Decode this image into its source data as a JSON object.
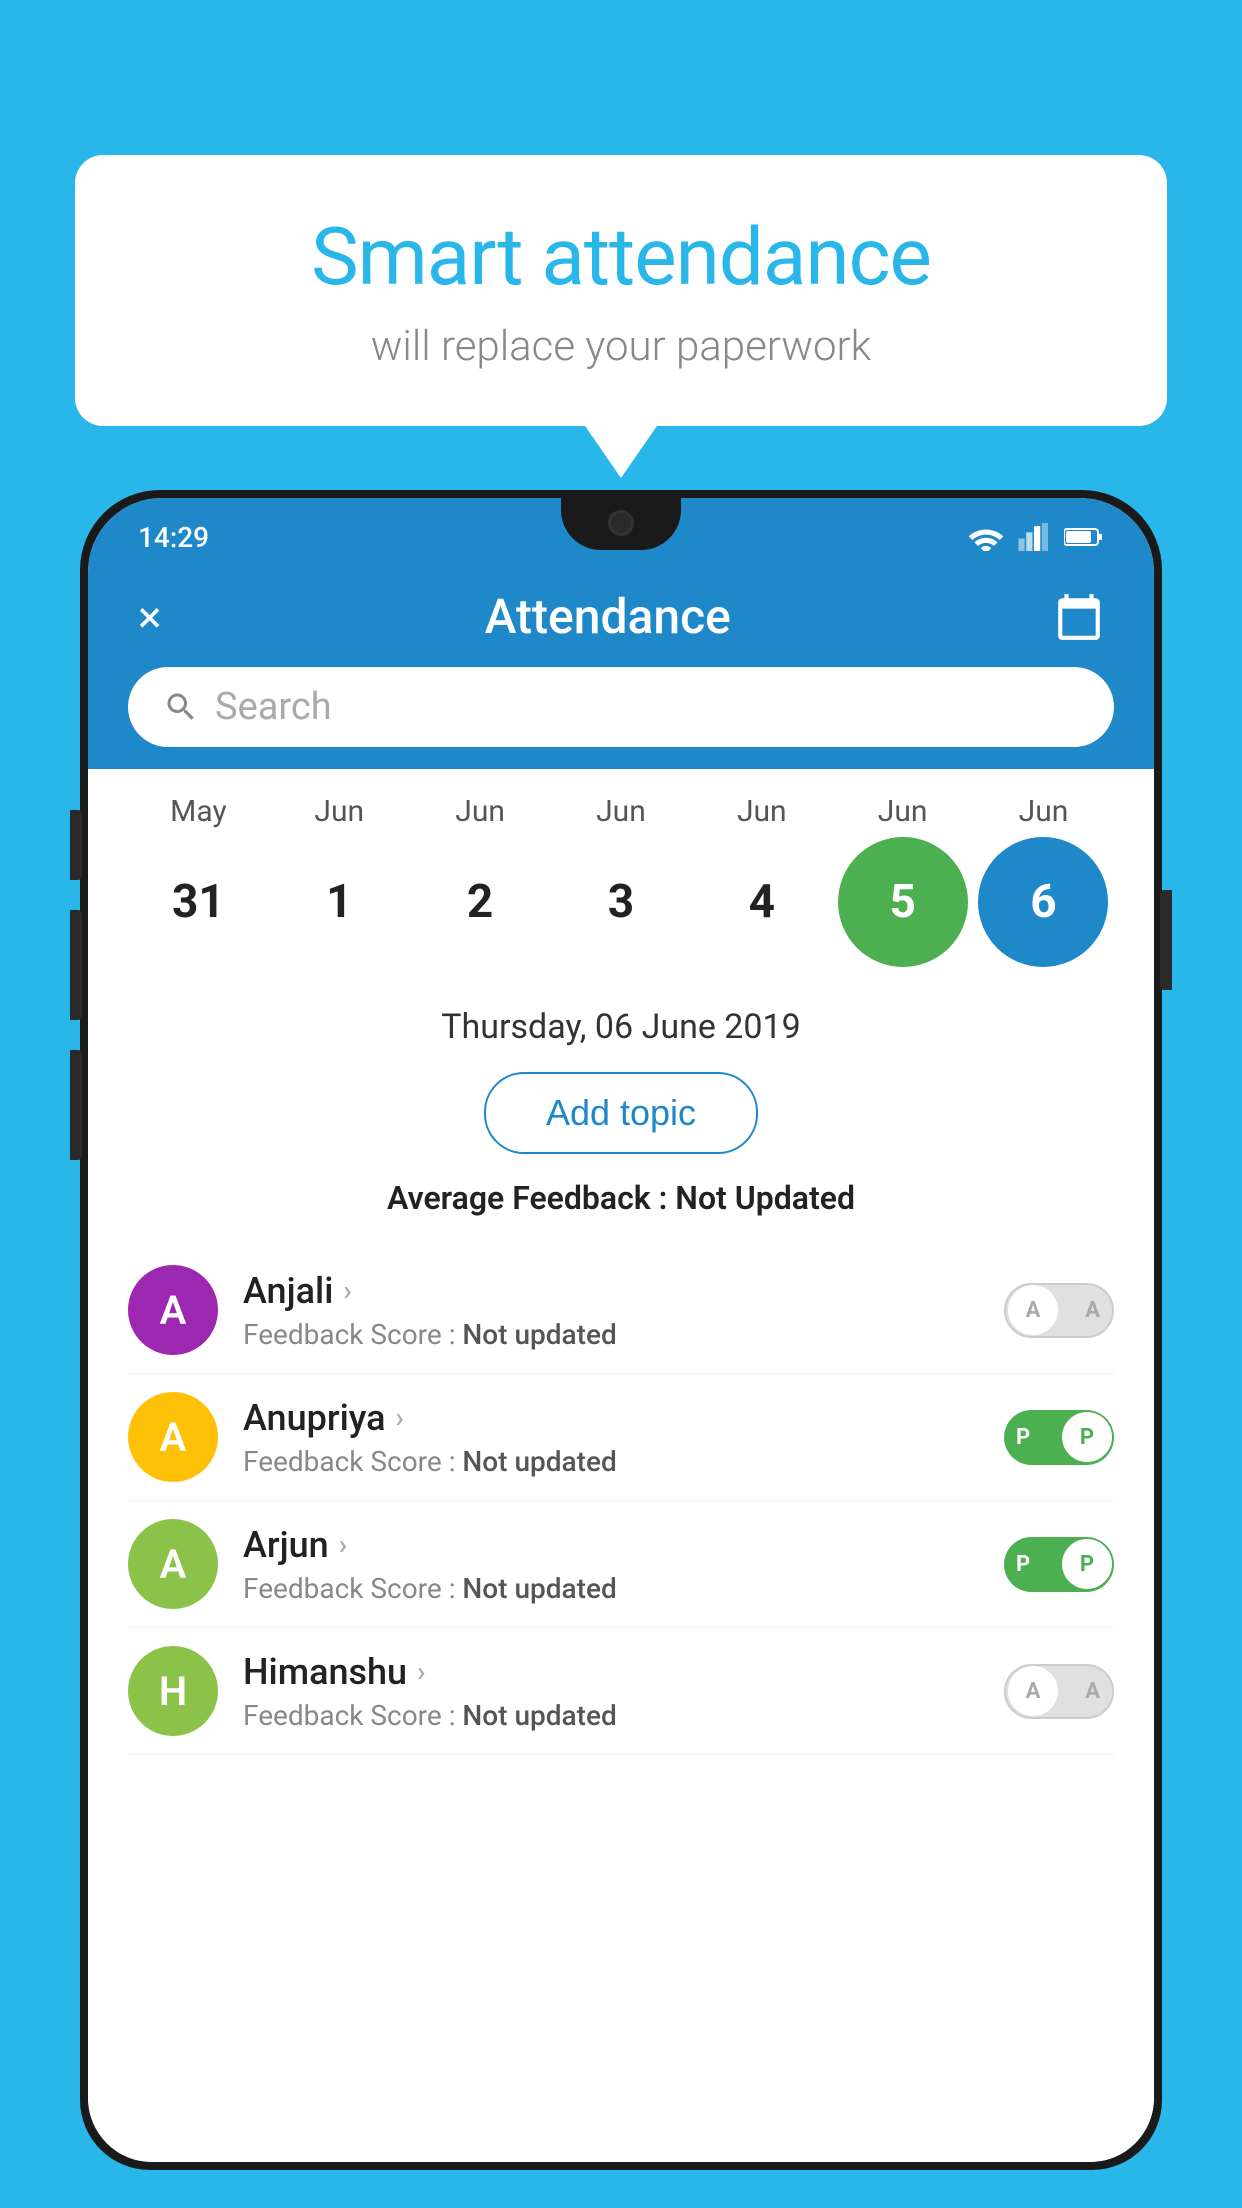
{
  "background_color": "#29b6e8",
  "speech_bubble": {
    "title": "Smart attendance",
    "subtitle": "will replace your paperwork"
  },
  "status_bar": {
    "time": "14:29"
  },
  "app_bar": {
    "title": "Attendance",
    "close_label": "×",
    "calendar_icon": "calendar"
  },
  "search": {
    "placeholder": "Search"
  },
  "calendar": {
    "months": [
      "May",
      "Jun",
      "Jun",
      "Jun",
      "Jun",
      "Jun",
      "Jun"
    ],
    "dates": [
      "31",
      "1",
      "2",
      "3",
      "4",
      "5",
      "6"
    ],
    "states": [
      "normal",
      "normal",
      "normal",
      "normal",
      "normal",
      "today",
      "selected"
    ]
  },
  "selected_date": "Thursday, 06 June 2019",
  "add_topic_label": "Add topic",
  "avg_feedback": {
    "label": "Average Feedback :",
    "value": "Not Updated"
  },
  "students": [
    {
      "name": "Anjali",
      "avatar_letter": "A",
      "avatar_color": "#9c27b0",
      "feedback_label": "Feedback Score :",
      "feedback_value": "Not updated",
      "toggle_state": "off",
      "toggle_value": "A"
    },
    {
      "name": "Anupriya",
      "avatar_letter": "A",
      "avatar_color": "#ffc107",
      "feedback_label": "Feedback Score :",
      "feedback_value": "Not updated",
      "toggle_state": "on",
      "toggle_value": "P"
    },
    {
      "name": "Arjun",
      "avatar_letter": "A",
      "avatar_color": "#8bc34a",
      "feedback_label": "Feedback Score :",
      "feedback_value": "Not updated",
      "toggle_state": "on",
      "toggle_value": "P"
    },
    {
      "name": "Himanshu",
      "avatar_letter": "H",
      "avatar_color": "#8bc34a",
      "feedback_label": "Feedback Score :",
      "feedback_value": "Not updated",
      "toggle_state": "off",
      "toggle_value": "A"
    }
  ]
}
